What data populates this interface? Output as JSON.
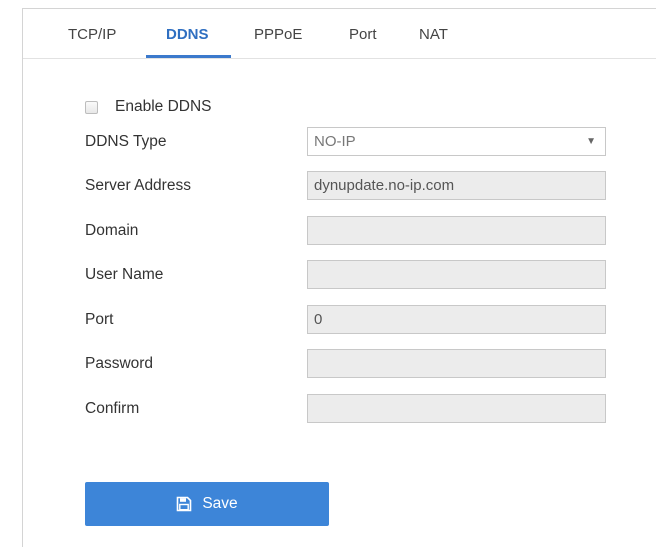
{
  "tabs": [
    {
      "label": "TCP/IP"
    },
    {
      "label": "DDNS"
    },
    {
      "label": "PPPoE"
    },
    {
      "label": "Port"
    },
    {
      "label": "NAT"
    }
  ],
  "active_tab": "DDNS",
  "enable_ddns": {
    "label": "Enable DDNS",
    "checked": false
  },
  "form": {
    "ddns_type": {
      "label": "DDNS Type",
      "value": "NO-IP",
      "arrow": "▼"
    },
    "server_address": {
      "label": "Server Address",
      "value": "dynupdate.no-ip.com"
    },
    "domain": {
      "label": "Domain",
      "value": ""
    },
    "user_name": {
      "label": "User Name",
      "value": ""
    },
    "port": {
      "label": "Port",
      "value": "0"
    },
    "password": {
      "label": "Password",
      "value": ""
    },
    "confirm": {
      "label": "Confirm",
      "value": ""
    }
  },
  "save_button": {
    "label": "Save",
    "icon": "save-icon"
  },
  "colors": {
    "accent": "#3d85d8",
    "active_tab_text": "#2f6fc1",
    "field_disabled_bg": "#ececec"
  }
}
